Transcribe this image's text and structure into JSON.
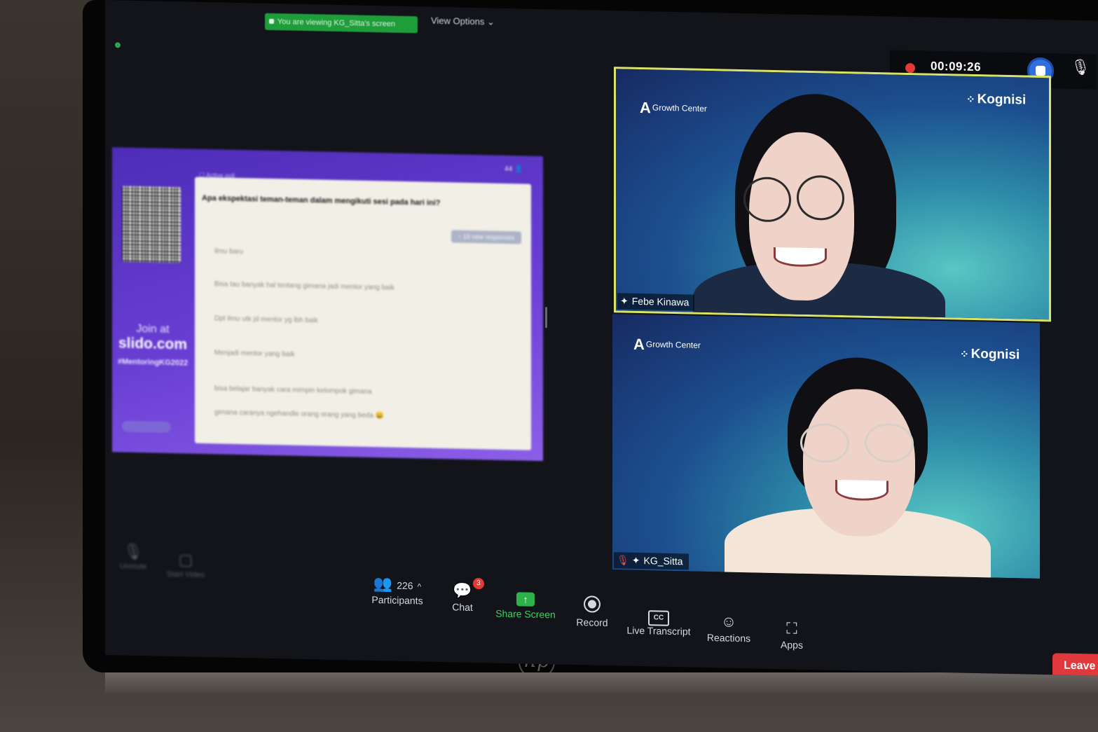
{
  "banner": {
    "viewing_text": "You are viewing KG_Sitta's screen"
  },
  "view_options": {
    "label": "View Options",
    "chevron": "chevron-down-icon"
  },
  "recording": {
    "timer": "00:09:26",
    "status_color": "#e53935"
  },
  "slide": {
    "active_poll_label": "Active poll",
    "participant_count": "44",
    "join_line1": "Join at",
    "join_line2": "slido.com",
    "hashtag": "#MentoringKG2022",
    "question": "Apa ekspektasi teman-teman dalam mengikuti sesi pada hari ini?",
    "new_responses": "19 new responses",
    "responses": [
      "ilmu baru",
      "Bisa tau banyak hal tentang gimana jadi mentor yang baik",
      "Dpt ilmu utk jd mentor yg lbh baik",
      "Menjadi mentor yang baik",
      "bisa belajar banyak cara mimpin kelompok gimana",
      "gimana caranya ngehandle orang orang yang beda 😄"
    ]
  },
  "tiles": [
    {
      "name": "Febe Kinawa",
      "brand_left": "Growth Center",
      "brand_right": "Kognisi",
      "border_color": "#d9e36a"
    },
    {
      "name": "KG_Sitta",
      "brand_left": "Growth Center",
      "brand_right": "Kognisi"
    }
  ],
  "toolbar": {
    "unmute": "Unmute",
    "start_video": "Start Video",
    "participants_count": "226",
    "participants": "Participants",
    "chat": "Chat",
    "chat_badge": "3",
    "share_screen": "Share Screen",
    "record": "Record",
    "cc": "CC",
    "live_transcript": "Live Transcript",
    "reactions": "Reactions",
    "apps": "Apps",
    "leave": "Leave"
  },
  "colors": {
    "accent_green": "#1f9d3a",
    "leave_red": "#e0383b",
    "slido_purple": "#6a3fd4"
  }
}
